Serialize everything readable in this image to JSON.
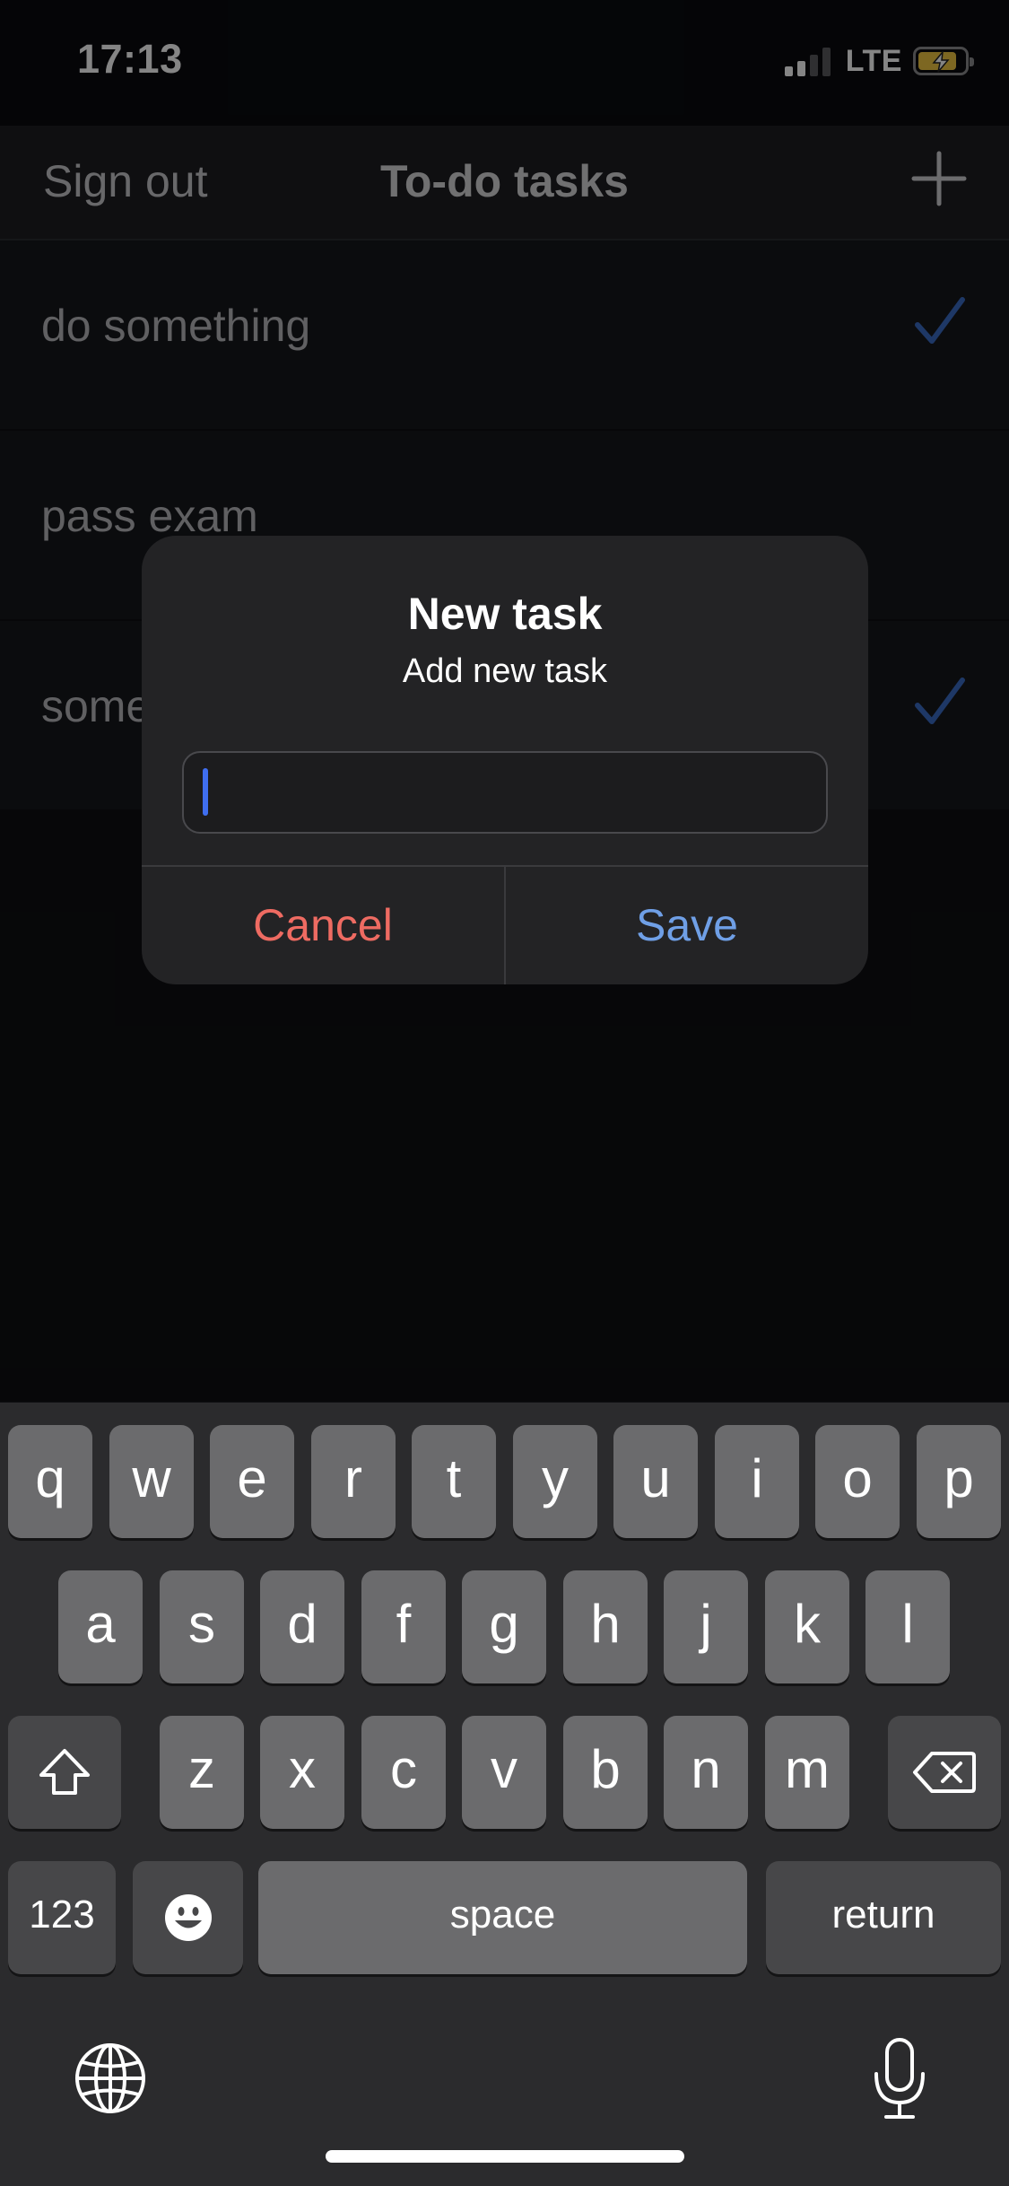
{
  "status_bar": {
    "time": "17:13",
    "network": "LTE"
  },
  "nav": {
    "left_button": "Sign out",
    "title": "To-do tasks",
    "right_icon": "plus-icon"
  },
  "tasks": [
    {
      "label": "do something",
      "checked": true
    },
    {
      "label": "pass exam",
      "checked": false
    },
    {
      "label": "some",
      "checked": true
    }
  ],
  "dialog": {
    "title": "New task",
    "subtitle": "Add new task",
    "input_value": "",
    "cancel_label": "Cancel",
    "save_label": "Save"
  },
  "keyboard": {
    "row1": [
      "q",
      "w",
      "e",
      "r",
      "t",
      "y",
      "u",
      "i",
      "o",
      "p"
    ],
    "row2": [
      "a",
      "s",
      "d",
      "f",
      "g",
      "h",
      "j",
      "k",
      "l"
    ],
    "row3": [
      "z",
      "x",
      "c",
      "v",
      "b",
      "n",
      "m"
    ],
    "numbers_label": "123",
    "space_label": "space",
    "return_label": "return"
  },
  "colors": {
    "accent_blue": "#6f9fe6",
    "destructive_red": "#ee6b62",
    "check_blue": "#3a6bc4",
    "caret_blue": "#3f6ef0"
  }
}
